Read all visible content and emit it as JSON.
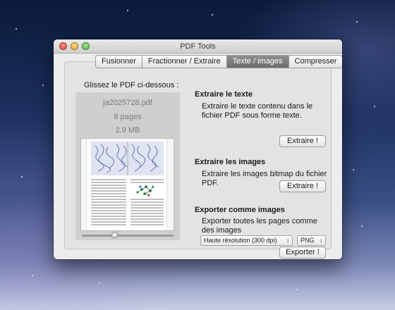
{
  "window": {
    "title": "PDF Tools"
  },
  "tabs": [
    {
      "label": "Fusionner"
    },
    {
      "label": "Fractionner / Extraire"
    },
    {
      "label": "Texte / images",
      "active": true
    },
    {
      "label": "Compresser"
    }
  ],
  "drop": {
    "label": "Glissez le PDF ci-dessous :",
    "file_name": "ja2025728.pdf",
    "pages": "8 pages",
    "size": "2.9 MB"
  },
  "extract_text": {
    "title": "Extraire le texte",
    "description": "Extraire le texte contenu dans le fichier PDF sous forme texte.",
    "button": "Extraire !"
  },
  "extract_images": {
    "title": "Extraire les images",
    "description": "Extraire les images bitmap du fichier PDF.",
    "button": "Extraire !"
  },
  "export_images": {
    "title": "Exporter comme images",
    "description": "Exporter toutes les pages comme des images",
    "resolution": "Haute résolution (300 dpi)",
    "format": "PNG",
    "button": "Exporter !"
  },
  "colors": {
    "active_tab": "#7a7a7a",
    "panel": "#e3e3e3"
  }
}
